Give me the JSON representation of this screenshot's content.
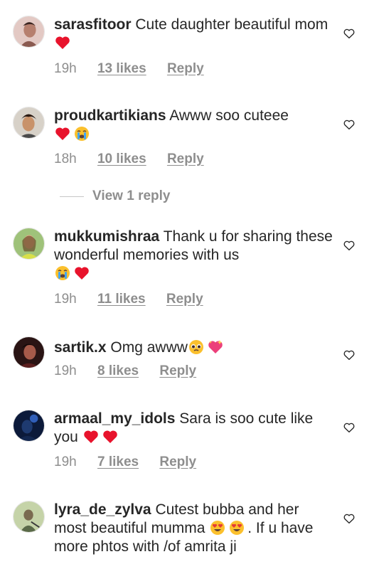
{
  "comments": [
    {
      "username": "sarasfitoor",
      "text": "Cute daughter beautiful mom",
      "emojis": [
        "red-heart"
      ],
      "time": "19h",
      "likes": "13 likes",
      "reply": "Reply"
    },
    {
      "username": "proudkartikians",
      "text": "Awww soo cuteee",
      "emojis": [
        "red-heart",
        "loudly-crying-face"
      ],
      "time": "18h",
      "likes": "10 likes",
      "reply": "Reply"
    },
    {
      "username": "mukkumishraa",
      "text": "Thank u for sharing these wonderful memories with us",
      "emojis": [
        "loudly-crying-face",
        "red-heart"
      ],
      "time": "19h",
      "likes": "11 likes",
      "reply": "Reply"
    },
    {
      "username": "sartik.x",
      "text": "Omg awww",
      "emojis": [
        "pleading-face",
        "sparkling-heart"
      ],
      "time": "19h",
      "likes": "8 likes",
      "reply": "Reply"
    },
    {
      "username": "armaal_my_idols",
      "text": "Sara is soo cute like you",
      "emojis": [
        "red-heart",
        "red-heart"
      ],
      "time": "19h",
      "likes": "7 likes",
      "reply": "Reply"
    },
    {
      "username": "lyra_de_zylva",
      "text": "Cutest bubba and her most beautiful mumma",
      "text_after": ". If u have more phtos with /of amrita ji",
      "emojis": [
        "heart-eyes-face",
        "heart-eyes-face"
      ]
    }
  ],
  "view_replies": "View 1 reply",
  "icons": {
    "like": "heart-outline-icon"
  },
  "colors": {
    "text": "#262626",
    "muted": "#8e8e8e",
    "heart": "#e8132c"
  }
}
